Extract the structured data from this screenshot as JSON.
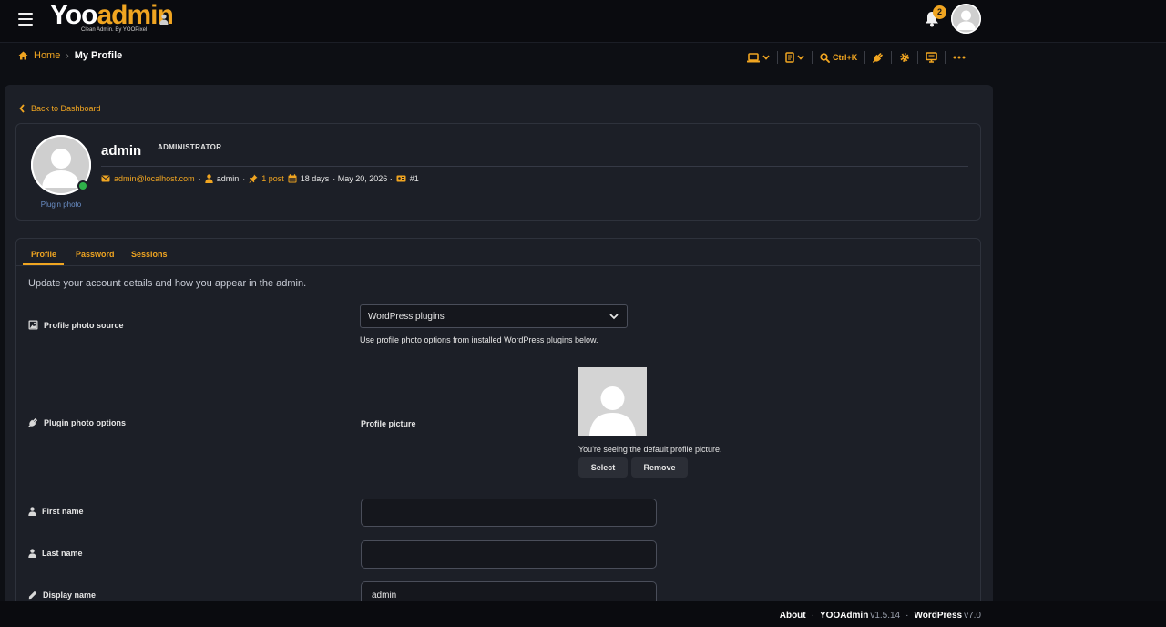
{
  "colors": {
    "accent": "#f0a521",
    "online": "#2fb24a",
    "link": "#6b8fc7"
  },
  "header": {
    "logo_y": "Yoo",
    "logo_a": "admin",
    "tagline": "Clean Admin. By YOOPixel",
    "notification_count": "2"
  },
  "breadcrumb": {
    "home": "Home",
    "current": "My Profile"
  },
  "toolbar": {
    "search_shortcut": "Ctrl+K"
  },
  "page": {
    "back_label": "Back to Dashboard"
  },
  "profile": {
    "username": "admin",
    "role": "ADMINISTRATOR",
    "photo_caption": "Plugin photo",
    "email": "admin@localhost.com",
    "login": "admin",
    "posts": "1 post",
    "member_for": "18 days",
    "date": "· May 20, 2026 ·",
    "id": "#1"
  },
  "tabs": [
    {
      "label": "Profile",
      "active": true
    },
    {
      "label": "Password",
      "active": false
    },
    {
      "label": "Sessions",
      "active": false
    }
  ],
  "form": {
    "intro": "Update your account details and how you appear in the admin.",
    "photo_source_label": "Profile photo source",
    "photo_source_value": "WordPress plugins",
    "photo_source_hint": "Use profile photo options from installed WordPress plugins below.",
    "plugin_options_label": "Plugin photo options",
    "profile_picture_label": "Profile picture",
    "default_picture_text": "You're seeing the default profile picture.",
    "select_button": "Select",
    "remove_button": "Remove",
    "first_name_label": "First name",
    "first_name_value": "",
    "last_name_label": "Last name",
    "last_name_value": "",
    "display_name_label": "Display name",
    "display_name_value": "admin"
  },
  "footer": {
    "about": "About",
    "yooadmin": "YOOAdmin",
    "yooadmin_version": "v1.5.14",
    "wordpress": "WordPress",
    "wordpress_version": "v7.0",
    "sep": "·"
  }
}
